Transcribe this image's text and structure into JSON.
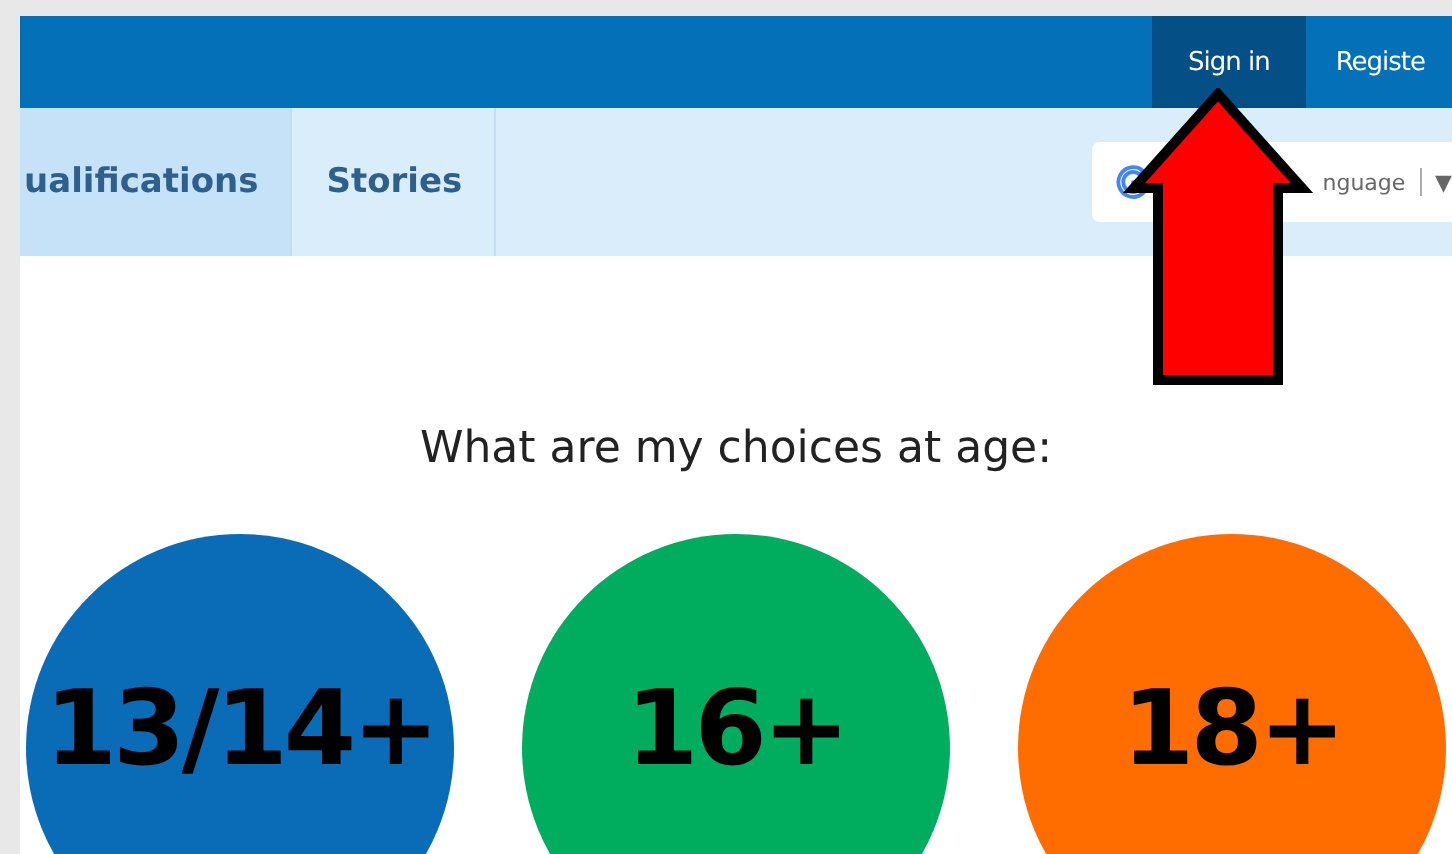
{
  "top_bar": {
    "links": [
      {
        "label": "Sign in",
        "selected": true
      },
      {
        "label": "Registe",
        "selected": false
      }
    ]
  },
  "nav": {
    "tabs": [
      {
        "label": "ualifications",
        "selected": true
      },
      {
        "label": "Stories",
        "selected": false
      }
    ],
    "translate": {
      "label": "nguage",
      "caret": "▼"
    }
  },
  "content": {
    "heading": "What are my choices at age:",
    "choices": [
      {
        "label": "13/14+",
        "color": "#0a6cb6"
      },
      {
        "label": "16+",
        "color": "#00ad5f"
      },
      {
        "label": "18+",
        "color": "#ff6c00"
      }
    ]
  }
}
